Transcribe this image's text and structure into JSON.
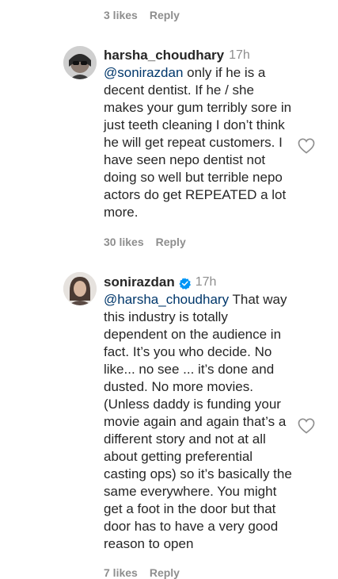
{
  "top_comment": {
    "likes": "3 likes",
    "reply": "Reply"
  },
  "comments": [
    {
      "username": "harsha_choudhary",
      "time": "17h",
      "verified": false,
      "mention": "@sonirazdan",
      "text": " only if he is a decent dentist. If he / she makes your gum terribly sore in just teeth cleaning I don’t think he will get repeat customers. I have seen nepo dentist not doing so well but terrible nepo actors do get REPEATED a lot more.",
      "likes": "30 likes",
      "reply": "Reply"
    },
    {
      "username": "sonirazdan",
      "time": "17h",
      "verified": true,
      "mention": "@harsha_choudhary",
      "text": " That way this industry is totally dependent on the audience in fact. It’s you who decide. No like... no see ... it’s done and dusted. No more movies. (Unless daddy is funding your movie again and again that’s a different story and not at all about getting preferential casting ops) so it’s basically the same everywhere. You might get a foot in the door but that door has to have a very good reason to open",
      "likes": "7 likes",
      "reply": "Reply"
    }
  ],
  "colors": {
    "text": "#262626",
    "muted": "#8e8e8e",
    "mention": "#00376b",
    "verified": "#0095f6"
  },
  "icons": [
    "heart-icon",
    "verified-badge-icon"
  ]
}
